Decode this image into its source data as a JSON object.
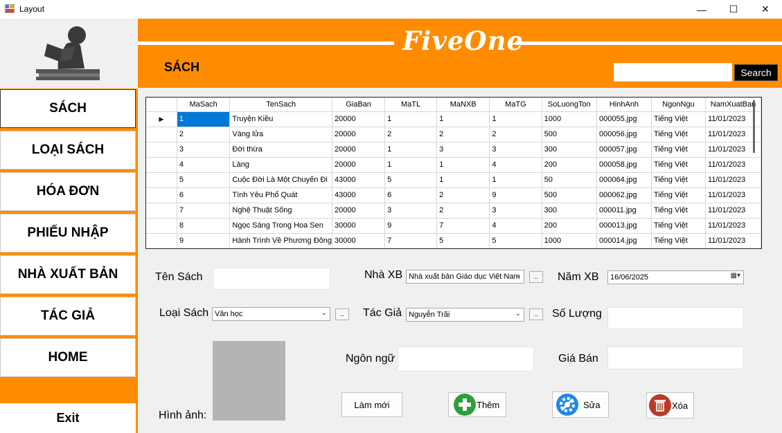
{
  "window": {
    "title": "Layout",
    "minimize_glyph": "—",
    "maximize_glyph": "☐",
    "close_glyph": "✕"
  },
  "sidebar": {
    "logo_icon": "reading-child-icon",
    "items": [
      {
        "label": "SÁCH"
      },
      {
        "label": "LOẠI SÁCH"
      },
      {
        "label": "HÓA ĐƠN"
      },
      {
        "label": "PHIẾU NHẬP"
      },
      {
        "label": "NHÀ XUẤT BẢN"
      },
      {
        "label": "TÁC GIẢ"
      },
      {
        "label": "HOME"
      }
    ],
    "exit_label": "Exit"
  },
  "header": {
    "brand": "FiveOne",
    "page_title": "SÁCH",
    "search_placeholder": "",
    "search_label": "Search"
  },
  "grid": {
    "columns": [
      "MaSach",
      "TenSach",
      "GiaBan",
      "MaTL",
      "MaNXB",
      "MaTG",
      "SoLuongTon",
      "HinhAnh",
      "NgonNgu",
      "NamXuatBan"
    ],
    "rows": [
      [
        "1",
        "Truyện Kiều",
        "20000",
        "1",
        "1",
        "1",
        "1000",
        "000055.jpg",
        "Tiếng Việt",
        "11/01/2023"
      ],
      [
        "2",
        "Vàng lửa",
        "20000",
        "2",
        "2",
        "2",
        "500",
        "000056.jpg",
        "Tiếng Việt",
        "11/01/2023"
      ],
      [
        "3",
        "Đời thừa",
        "20000",
        "1",
        "3",
        "3",
        "300",
        "000057.jpg",
        "Tiếng Việt",
        "11/01/2023"
      ],
      [
        "4",
        "Làng",
        "20000",
        "1",
        "1",
        "4",
        "200",
        "000058.jpg",
        "Tiếng Việt",
        "11/01/2023"
      ],
      [
        "5",
        "Cuộc Đời Là Một Chuyến Đi",
        "43000",
        "5",
        "1",
        "1",
        "50",
        "000064.jpg",
        "Tiếng Việt",
        "11/01/2023"
      ],
      [
        "6",
        "Tình Yêu Phổ Quát",
        "43000",
        "6",
        "2",
        "9",
        "500",
        "000062.jpg",
        "Tiếng Việt",
        "11/01/2023"
      ],
      [
        "7",
        "Nghệ Thuật Sống",
        "20000",
        "3",
        "2",
        "3",
        "300",
        "000011.jpg",
        "Tiếng Việt",
        "11/01/2023"
      ],
      [
        "8",
        "Ngọc Sáng Trong Hoa Sen",
        "30000",
        "9",
        "7",
        "4",
        "200",
        "000013.jpg",
        "Tiếng Việt",
        "11/01/2023"
      ],
      [
        "9",
        "Hành Trình Về Phương Đông",
        "30000",
        "7",
        "5",
        "5",
        "1000",
        "000014.jpg",
        "Tiếng Việt",
        "11/01/2023"
      ]
    ],
    "selected_row": 0
  },
  "form": {
    "ten_sach_label": "Tên Sách",
    "ten_sach_value": "",
    "nha_xb_label": "Nhà XB",
    "nha_xb_value": "Nhà xuất bản Giáo dục Việt Nam",
    "nam_xb_label": "Năm XB",
    "nam_xb_value": "16/06/2025",
    "loai_sach_label": "Loại Sách",
    "loai_sach_value": "Văn học",
    "tac_gia_label": "Tác Giả",
    "tac_gia_value": "Nguyễn Trãi",
    "so_luong_label": "Số Lượng",
    "so_luong_value": "",
    "ngon_ngu_label": "Ngôn ngữ",
    "ngon_ngu_value": "",
    "gia_ban_label": "Giá Bán",
    "gia_ban_value": "",
    "hinh_anh_label": "Hình ảnh:",
    "browse_label": ".."
  },
  "actions": {
    "refresh_label": "Làm mới",
    "add_label": "Thêm",
    "edit_label": "Sửa",
    "delete_label": "Xóa"
  },
  "colors": {
    "accent": "#ff8c00",
    "selection": "#0078d7",
    "add_green": "#2e9e3a",
    "edit_blue": "#1e88e5",
    "delete_red": "#b83a2a"
  }
}
